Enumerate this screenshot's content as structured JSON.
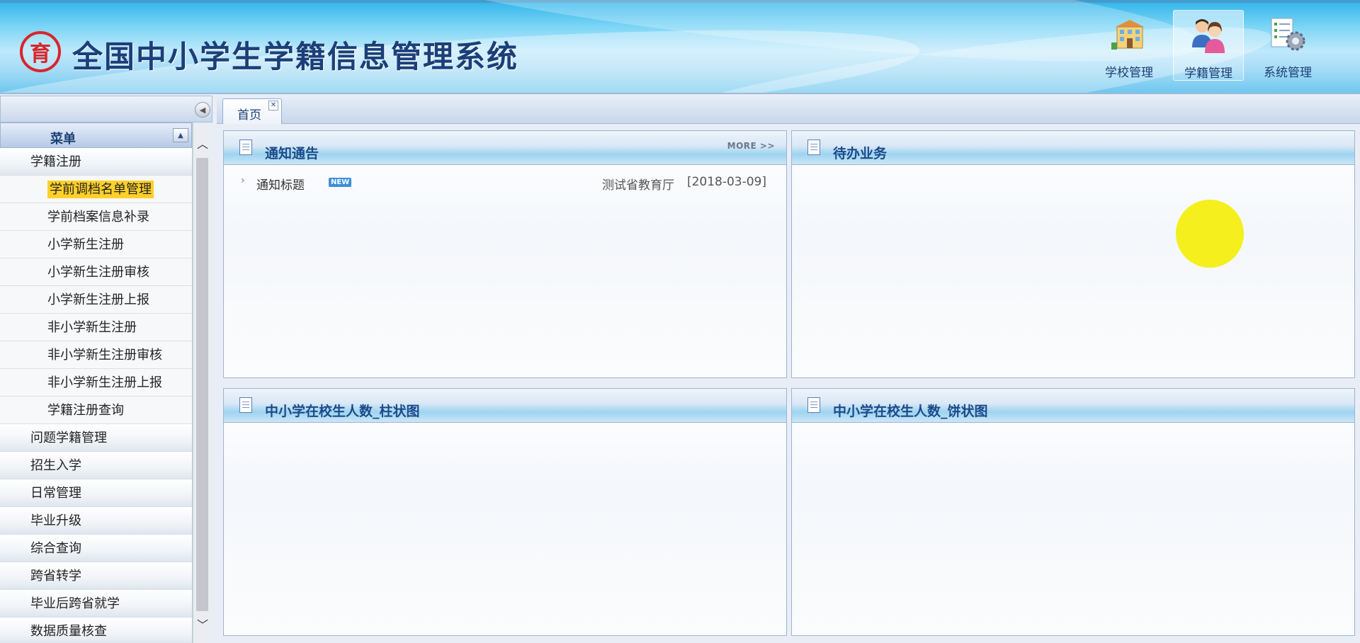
{
  "app": {
    "title": "全国中小学生学籍信息管理系统",
    "logo_text": "育",
    "top_nav": [
      {
        "label": "学校管理",
        "icon": "school-building-icon",
        "active": false
      },
      {
        "label": "学籍管理",
        "icon": "students-icon",
        "active": true
      },
      {
        "label": "系统管理",
        "icon": "system-gear-icon",
        "active": false
      }
    ]
  },
  "sidebar": {
    "menu_title": "菜单",
    "groups": [
      {
        "label": "学籍注册",
        "expanded": true,
        "items": [
          "学前调档名单管理",
          "学前档案信息补录",
          "小学新生注册",
          "小学新生注册审核",
          "小学新生注册上报",
          "非小学新生注册",
          "非小学新生注册审核",
          "非小学新生注册上报",
          "学籍注册查询"
        ],
        "selected": "学前调档名单管理"
      },
      {
        "label": "问题学籍管理"
      },
      {
        "label": "招生入学"
      },
      {
        "label": "日常管理"
      },
      {
        "label": "毕业升级"
      },
      {
        "label": "综合查询"
      },
      {
        "label": "跨省转学"
      },
      {
        "label": "毕业后跨省就学"
      },
      {
        "label": "数据质量核查"
      }
    ]
  },
  "tabs": [
    {
      "label": "首页",
      "close": "✕"
    }
  ],
  "panels": {
    "notice": {
      "title": "通知通告",
      "more_label": "MORE >>",
      "rows": [
        {
          "title": "通知标题",
          "badge": "NEW",
          "source": "测试省教育厅",
          "date": "[2018-03-09]"
        }
      ]
    },
    "todo": {
      "title": "待办业务"
    },
    "bar": {
      "title": "中小学在校生人数_柱状图"
    },
    "pie": {
      "title": "中小学在校生人数_饼状图"
    }
  },
  "colors": {
    "accent": "#1b4a8a",
    "highlight": "#ffd02a",
    "logo": "#d8252b",
    "cursor_halo": "#f4ef1d"
  }
}
